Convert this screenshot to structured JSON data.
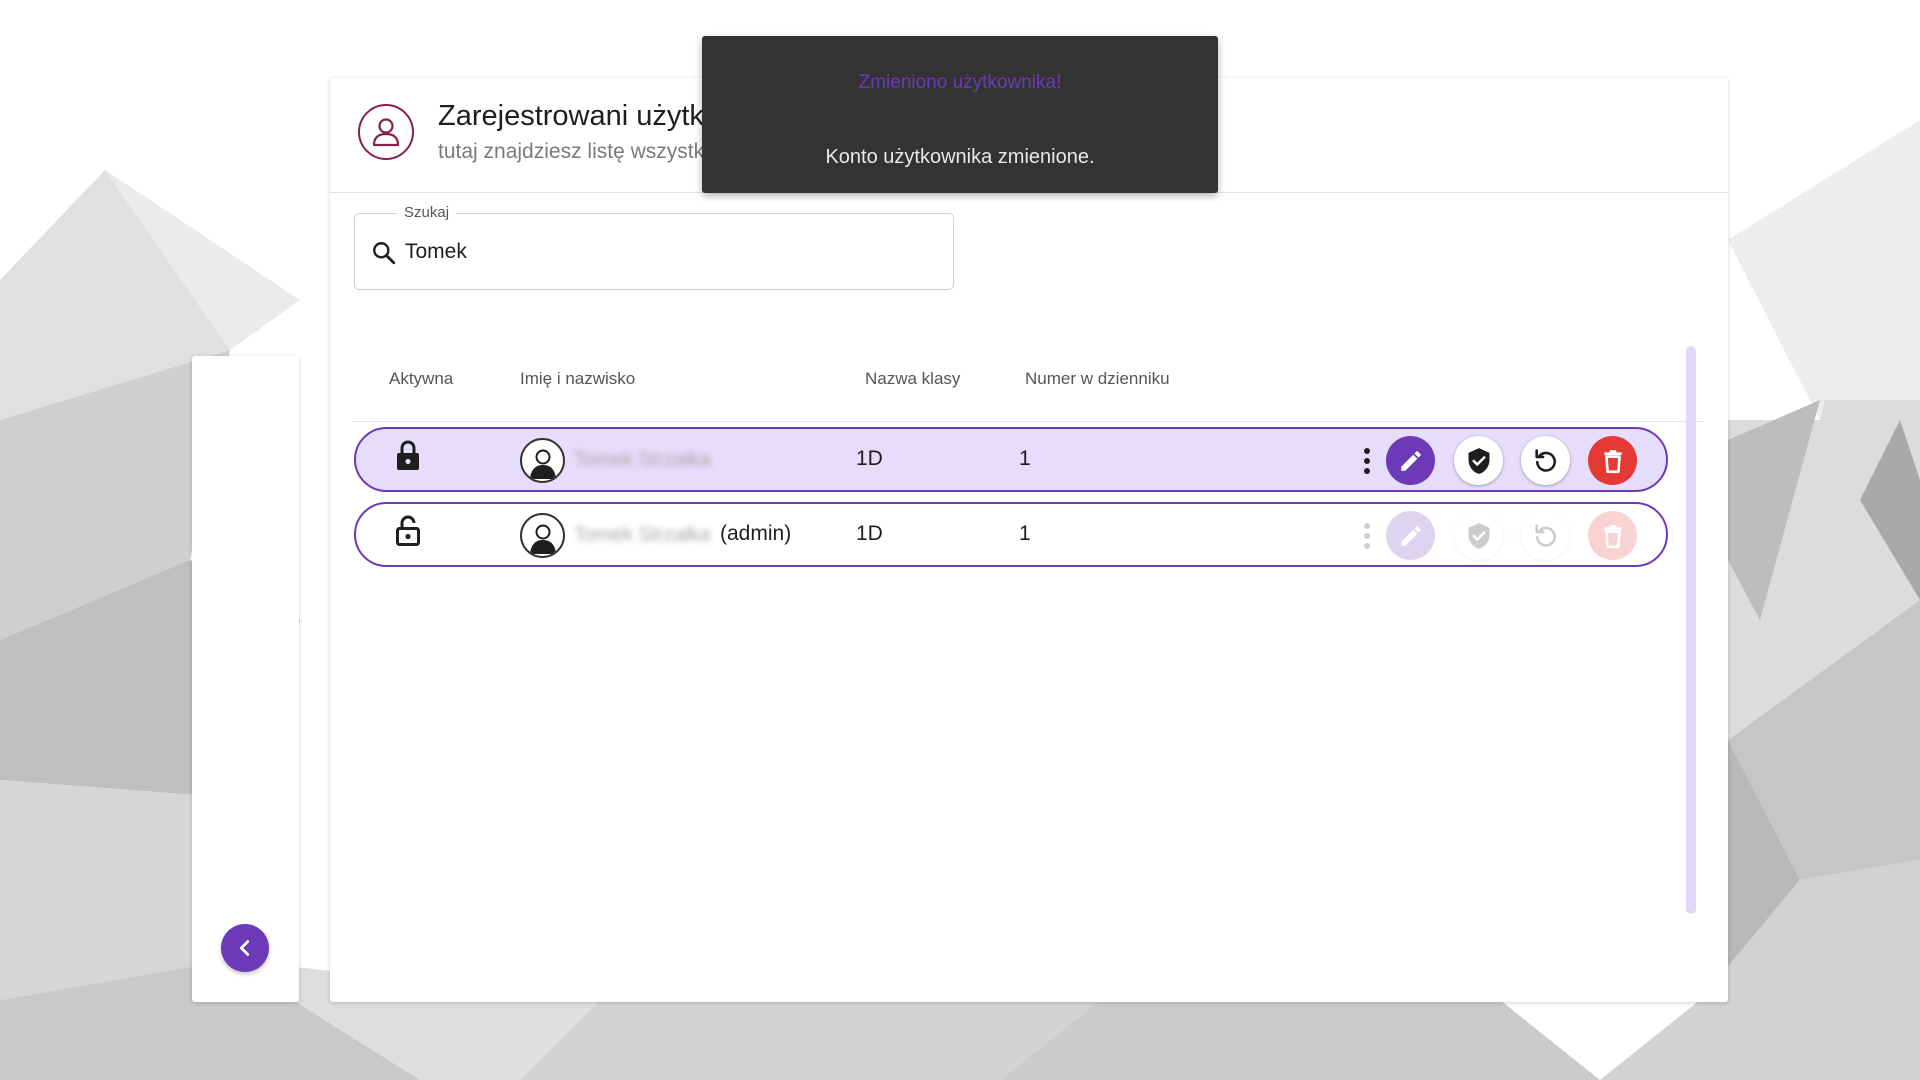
{
  "header": {
    "title": "Zarejestrowani użytkownicy",
    "subtitle": "tutaj znajdziesz listę wszystkich"
  },
  "search": {
    "label": "Szukaj",
    "value": "Tomek"
  },
  "table": {
    "columns": [
      "Aktywna",
      "Imię i nazwisko",
      "Nazwa klasy",
      "Numer w dzienniku"
    ],
    "rows": [
      {
        "active": "locked",
        "name": "Tomek Strzałka",
        "suffix": "",
        "class_name": "1D",
        "journal_number": "1",
        "selected": true
      },
      {
        "active": "unlocked",
        "name": "Tomek Strzałka",
        "suffix": "(admin)",
        "class_name": "1D",
        "journal_number": "1",
        "selected": false
      }
    ]
  },
  "toast": {
    "title": "Zmieniono użytkownika!",
    "message": "Konto użytkownika zmienione."
  },
  "icons": {
    "header": "user-outline-icon",
    "search": "search-icon",
    "locked": "lock-closed-icon",
    "unlocked": "lock-open-icon",
    "avatar": "user-avatar-icon",
    "more": "more-vertical-icon",
    "edit": "pencil-icon",
    "verify": "shield-check-icon",
    "reset": "reset-icon",
    "delete": "trash-icon",
    "back": "chevron-left-icon"
  },
  "colors": {
    "accent": "#6c3ab7",
    "selected_row_bg": "#e6dcfb",
    "delete": "#e53935",
    "toast_bg": "#333333",
    "header_icon": "#8a1e4d"
  }
}
